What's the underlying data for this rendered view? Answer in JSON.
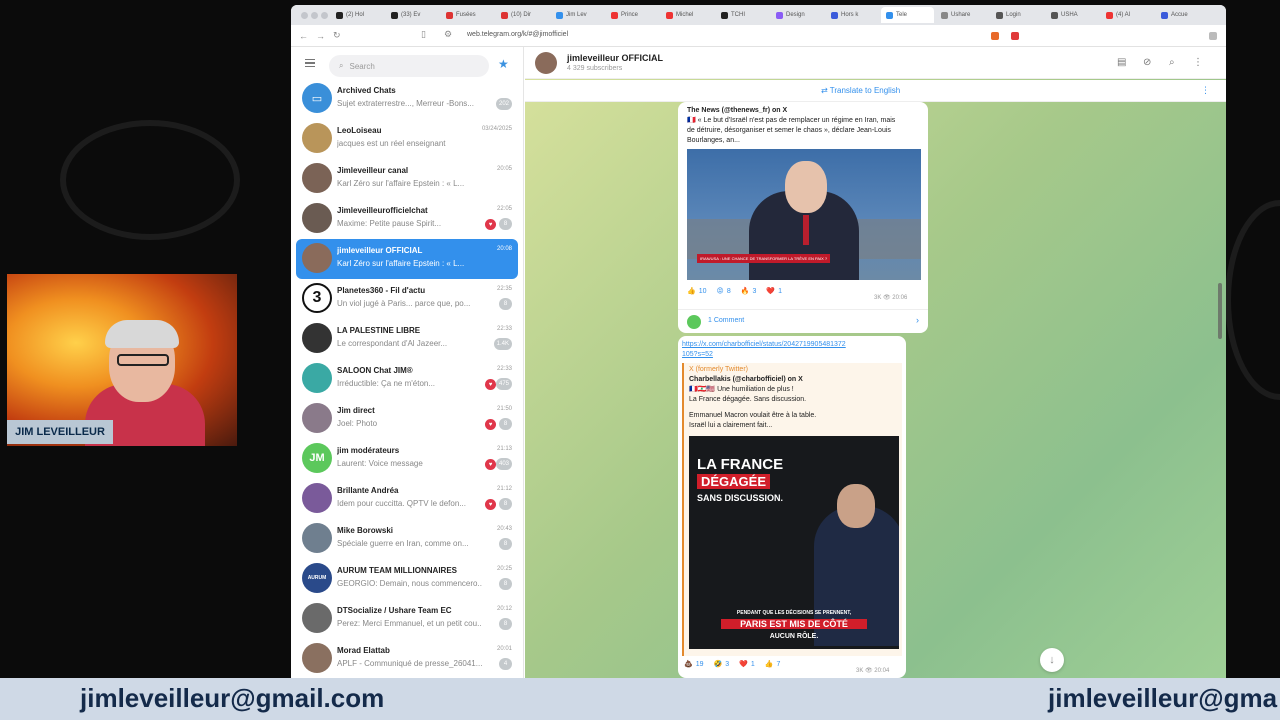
{
  "browser": {
    "tabs": [
      {
        "label": "(2) Hol",
        "color": "#222"
      },
      {
        "label": "(33) Ev",
        "color": "#222"
      },
      {
        "label": "Fusées",
        "color": "#d33"
      },
      {
        "label": "(10) Dir",
        "color": "#d33"
      },
      {
        "label": "Jim Lev",
        "color": "#3390ec"
      },
      {
        "label": "Prince",
        "color": "#e33"
      },
      {
        "label": "Michel",
        "color": "#e33"
      },
      {
        "label": "TCHI",
        "color": "#222"
      },
      {
        "label": "Design",
        "color": "#8a5cf5"
      },
      {
        "label": "Hors k",
        "color": "#3b5bdb"
      },
      {
        "label": "Tele",
        "color": "#3390ec",
        "active": true
      },
      {
        "label": "Ushare",
        "color": "#888"
      },
      {
        "label": "Login",
        "color": "#555"
      },
      {
        "label": "USHA",
        "color": "#555"
      },
      {
        "label": "(4) Al",
        "color": "#e33"
      },
      {
        "label": "Accue",
        "color": "#3b5bdb"
      }
    ],
    "url": "web.telegram.org/k/#@jimofficiel"
  },
  "sidebar": {
    "search_placeholder": "Search",
    "chats": [
      {
        "name": "Archived Chats",
        "msg": "Sujet extraterrestre..., Merreur -Bons...",
        "time": "",
        "badge": "202",
        "avatar_color": "#3a8fd9",
        "avatar_text": "▭"
      },
      {
        "name": "LeoLoiseau",
        "msg": "jacques est un réel enseignant",
        "time": "03/24/2025",
        "badge": "",
        "avatar_color": "#b9955a",
        "avatar_text": ""
      },
      {
        "name": "Jimleveilleur canal",
        "msg": "Karl Zéro sur l'affaire Epstein : « L...",
        "time": "20:05",
        "badge": "",
        "avatar_color": "#7b6356",
        "avatar_text": ""
      },
      {
        "name": "Jimleveilleurofficielchat",
        "msg": "Maxime: Petite pause Spirit...",
        "time": "22:05",
        "badge": "8",
        "heart": true,
        "avatar_color": "#6a5b52",
        "avatar_text": ""
      },
      {
        "name": "jimleveilleur OFFICIAL",
        "msg": "Karl Zéro sur l'affaire Epstein : « L...",
        "time": "20:08",
        "badge": "",
        "selected": true,
        "avatar_color": "#8a6b5b",
        "avatar_text": ""
      },
      {
        "name": "Planetes360 - Fil d'actu",
        "msg": "Un viol jugé à Paris... parce que, po...",
        "time": "22:35",
        "badge": "8",
        "avatar_color": "#fff",
        "avatar_text": "3"
      },
      {
        "name": "LA PALESTINE LIBRE",
        "msg": "Le correspondant d'Al Jazeer...",
        "time": "22:33",
        "badge": "1.4K",
        "avatar_color": "#333",
        "avatar_text": ""
      },
      {
        "name": "SALOON Chat JIM®",
        "msg": "Irréductible: Ça ne m'éton...",
        "time": "22:33",
        "badge": "475",
        "heart": true,
        "avatar_color": "#3aa9a4",
        "avatar_text": ""
      },
      {
        "name": "Jim direct",
        "msg": "Joel: Photo",
        "time": "21:50",
        "badge": "8",
        "heart": true,
        "avatar_color": "#8a7a8a",
        "avatar_text": ""
      },
      {
        "name": "jim modérateurs",
        "msg": "Laurent: Voice message",
        "time": "21:13",
        "badge": "403",
        "heart": true,
        "avatar_color": "#5cc85c",
        "avatar_text": "JM"
      },
      {
        "name": "Brillante Andréa",
        "msg": "Idem pour cuccitta. QPTV le defon...",
        "time": "21:12",
        "badge": "8",
        "heart": true,
        "avatar_color": "#7a5a9a",
        "avatar_text": ""
      },
      {
        "name": "Mike Borowski",
        "msg": "Spéciale guerre en Iran, comme on...",
        "time": "20:43",
        "badge": "8",
        "avatar_color": "#6f7f8f",
        "avatar_text": ""
      },
      {
        "name": "AURUM TEAM MILLIONNAIRES",
        "msg": "GEORGIO: Demain, nous commencero...",
        "time": "20:25",
        "badge": "8",
        "avatar_color": "#2a4a8a",
        "avatar_text": "AURUM"
      },
      {
        "name": "DTSocialize / Ushare Team EC",
        "msg": "Perez: Merci Emmanuel, et un petit cou...",
        "time": "20:12",
        "badge": "8",
        "avatar_color": "#6a6a6a",
        "avatar_text": ""
      },
      {
        "name": "Morad Elattab",
        "msg": "APLF - Communiqué de presse_26041...",
        "time": "20:01",
        "badge": "4",
        "avatar_color": "#8a7060",
        "avatar_text": ""
      }
    ]
  },
  "chat": {
    "title": "jimleveilleur OFFICIAL",
    "subscribers": "4 329 subscribers",
    "translate": "Translate to English",
    "post1": {
      "source": "The News (@thenews_fr) on X",
      "line1": "🇫🇷 « Le but d'Israël n'est pas de remplacer un régime en Iran, mais",
      "line2": "de détruire, désorganiser et semer le chaos », déclare Jean-Louis",
      "line3": "Bourlanges, an...",
      "reactions": [
        {
          "e": "👍",
          "n": "10"
        },
        {
          "e": "😡",
          "n": "8"
        },
        {
          "e": "🔥",
          "n": "3"
        },
        {
          "e": "❤️",
          "n": "1"
        }
      ],
      "views": "3K",
      "time": "20:06",
      "comments": "1 Comment",
      "tv_caption": "IRAN/USA : UNE CHANCE DE TRANSFORMER LA TRÊVE EN PAIX ?"
    },
    "post2": {
      "link": "https://x.com/charbofficiel/status/2042719905481372",
      "link2": "105?s=52",
      "source_site": "X (formerly Twitter)",
      "source": "Charbellakis (@charbofficiel) on X",
      "line1": "🇫🇷🇱🇧🇺🇸 Une humiliation de plus !",
      "line2": "La France dégagée. Sans discussion.",
      "line3": "Emmanuel Macron voulait être à la table.",
      "line4": "Israël lui a clairement fait...",
      "poster_title1": "LA FRANCE",
      "poster_title2": "DÉGAGÉE",
      "poster_title3": "SANS DISCUSSION.",
      "poster_bottom1": "PENDANT QUE LES DÉCISIONS SE PRENNENT,",
      "poster_bottom2": "PARIS EST MIS DE CÔTÉ",
      "poster_bottom3": "AUCUN RÔLE.",
      "reactions": [
        {
          "e": "💩",
          "n": "19"
        },
        {
          "e": "🤣",
          "n": "3"
        },
        {
          "e": "❤️",
          "n": "1"
        },
        {
          "e": "👍",
          "n": "7"
        }
      ],
      "views": "3K",
      "time": "20:04"
    }
  },
  "overlay": {
    "cam_label": "JIM LEVEILLEUR",
    "email": "jimleveilleur@gmail.com",
    "email_right": "jimleveilleur@gma"
  }
}
